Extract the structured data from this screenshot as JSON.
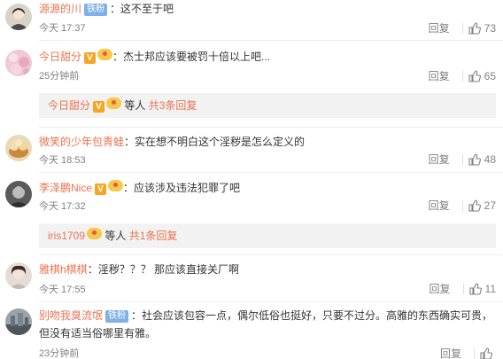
{
  "ui": {
    "reply_label": "回复"
  },
  "comments": [
    {
      "name": "源源的川",
      "fan": "铁粉",
      "text": "这不至于吧",
      "time": "今天 17:37",
      "likes": "73"
    },
    {
      "name": "今日甜分",
      "vbadge": "V",
      "text": "杰士邦应该要被罚十倍以上吧...",
      "time": "25分钟前",
      "likes": "65",
      "sub": {
        "name": "今日甜分",
        "vbadge": "V",
        "suffix": "等人",
        "total": "共3条回复"
      }
    },
    {
      "name": "微笑的少年包青蛙",
      "text": "实在想不明白这个淫秽是怎么定义的",
      "time": "今天 18:53",
      "likes": "48"
    },
    {
      "name": "李泽鹏Nice",
      "vbadge": "V",
      "text": "应该涉及违法犯罪了吧",
      "time": "今天 17:32",
      "likes": "27",
      "sub": {
        "name": "iris1709",
        "suffix": "等人",
        "total": "共1条回复"
      }
    },
    {
      "name": "雅棋h棋棋",
      "text": "淫秽？？？ 那应该直接关厂啊",
      "time": "今天 17:55",
      "likes": "11"
    },
    {
      "name": "别吻我臭流氓",
      "fan": "铁粉",
      "text": "社会应该包容一点，偶尔低俗也挺好，只要不过分。高雅的东西确实可贵，",
      "text2": "但没有适当俗哪里有雅。",
      "time": "23分钟前",
      "likes": ""
    }
  ],
  "colors": {
    "username": "#eb7350",
    "fan_badge": "#7fb0e8",
    "meta": "#808080",
    "v_badge": "#f6a623"
  },
  "icons": {
    "like": "thumbs-up-icon",
    "vip": "v-badge-icon",
    "medal": "medal-icon"
  }
}
